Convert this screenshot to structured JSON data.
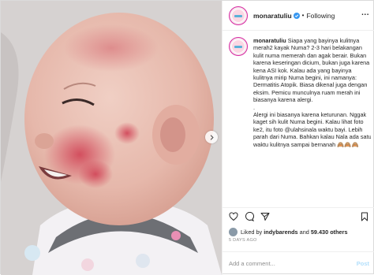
{
  "header": {
    "username": "monaratuliu",
    "separator": "•",
    "follow_label": "Following",
    "more_label": "..."
  },
  "caption": {
    "username": "monaratuliu",
    "text": "Siapa yang bayinya kulitnya merah2 kayak Numa? 2-3 hari belakangan kulit numa memerah dan agak berair. Bukan karena keseringan dicium, bukan juga karena kena ASI kok. Kalau ada yang bayinya kulitnya mirip Numa begini, ini namanya: Dermatitis Atopik. Biasa dikenal juga dengan eksim. Pemicu munculnya ruam merah ini biasanya karena alergi.\n.\nAlergi ini biasanya karena keturunan. Nggak kaget sih kulit Numa begini. Kalau lihat foto ke2, itu foto @ulahsinala waktu bayi. Lebih parah dari Numa. Bahkan kalau Nala ada satu waktu kulitnya sampai bernanah 🙈🙈🙈"
  },
  "likes": {
    "prefix": "Liked by",
    "user": "indybarends",
    "and": "and",
    "count": "59.430 others"
  },
  "timestamp": "5 DAYS AGO",
  "comment": {
    "placeholder": "Add a comment...",
    "post_label": "Post"
  },
  "icons": {
    "verified": "verified-badge-icon",
    "heart": "heart-icon",
    "comment": "comment-icon",
    "share": "share-icon",
    "save": "bookmark-icon",
    "next": "chevron-right-icon"
  },
  "colors": {
    "accent": "#0095f6",
    "post_disabled": "#b2dffc",
    "muted": "#8e8e8e",
    "text": "#262626"
  }
}
